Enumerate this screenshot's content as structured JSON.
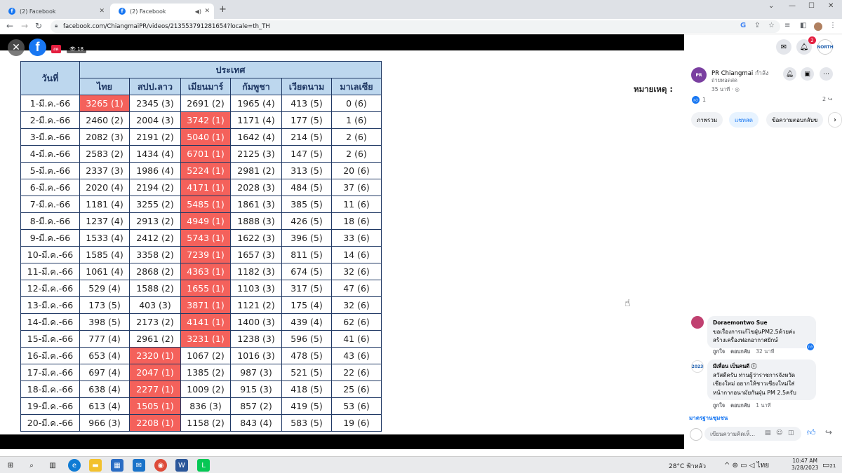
{
  "browser": {
    "tabs": [
      {
        "label": "(2) Facebook",
        "active": false
      },
      {
        "label": "(2) Facebook",
        "active": true
      }
    ],
    "url": "facebook.com/ChiangmaiPR/videos/213553791281654?locale=th_TH"
  },
  "viewer": {
    "live_badge": "สด",
    "views": "18",
    "note_label": "หมายเหตุ :",
    "table": {
      "header_date": "วันที่",
      "header_group": "ประเทศ",
      "countries": [
        "ไทย",
        "สปป.ลาว",
        "เมียนมาร์",
        "กัมพูชา",
        "เวียดนาม",
        "มาเลเซีย"
      ],
      "rows": [
        {
          "date": "1-มี.ค.-66",
          "cells": [
            "3265 (1)",
            "2345 (3)",
            "2691 (2)",
            "1965 (4)",
            "413 (5)",
            "0 (6)"
          ],
          "highlight": 0
        },
        {
          "date": "2-มี.ค.-66",
          "cells": [
            "2460 (2)",
            "2004 (3)",
            "3742 (1)",
            "1171 (4)",
            "177 (5)",
            "1 (6)"
          ],
          "highlight": 2
        },
        {
          "date": "3-มี.ค.-66",
          "cells": [
            "2082 (3)",
            "2191 (2)",
            "5040 (1)",
            "1642 (4)",
            "214 (5)",
            "2 (6)"
          ],
          "highlight": 2
        },
        {
          "date": "4-มี.ค.-66",
          "cells": [
            "2583 (2)",
            "1434 (4)",
            "6701 (1)",
            "2125 (3)",
            "147 (5)",
            "2 (6)"
          ],
          "highlight": 2
        },
        {
          "date": "5-มี.ค.-66",
          "cells": [
            "2337 (3)",
            "1986 (4)",
            "5224 (1)",
            "2981 (2)",
            "313 (5)",
            "20 (6)"
          ],
          "highlight": 2
        },
        {
          "date": "6-มี.ค.-66",
          "cells": [
            "2020 (4)",
            "2194 (2)",
            "4171 (1)",
            "2028 (3)",
            "484 (5)",
            "37 (6)"
          ],
          "highlight": 2
        },
        {
          "date": "7-มี.ค.-66",
          "cells": [
            "1181 (4)",
            "3255 (2)",
            "5485 (1)",
            "1861 (3)",
            "385 (5)",
            "11 (6)"
          ],
          "highlight": 2
        },
        {
          "date": "8-มี.ค.-66",
          "cells": [
            "1237 (4)",
            "2913 (2)",
            "4949 (1)",
            "1888 (3)",
            "426 (5)",
            "18 (6)"
          ],
          "highlight": 2
        },
        {
          "date": "9-มี.ค.-66",
          "cells": [
            "1533 (4)",
            "2412 (2)",
            "5743 (1)",
            "1622 (3)",
            "396 (5)",
            "33 (6)"
          ],
          "highlight": 2
        },
        {
          "date": "10-มี.ค.-66",
          "cells": [
            "1585 (4)",
            "3358 (2)",
            "7239 (1)",
            "1657 (3)",
            "811 (5)",
            "14 (6)"
          ],
          "highlight": 2
        },
        {
          "date": "11-มี.ค.-66",
          "cells": [
            "1061 (4)",
            "2868 (2)",
            "4363 (1)",
            "1182 (3)",
            "674 (5)",
            "32 (6)"
          ],
          "highlight": 2
        },
        {
          "date": "12-มี.ค.-66",
          "cells": [
            "529 (4)",
            "1588 (2)",
            "1655 (1)",
            "1103 (3)",
            "317 (5)",
            "47 (6)"
          ],
          "highlight": 2
        },
        {
          "date": "13-มี.ค.-66",
          "cells": [
            "173 (5)",
            "403 (3)",
            "3871 (1)",
            "1121 (2)",
            "175 (4)",
            "32 (6)"
          ],
          "highlight": 2
        },
        {
          "date": "14-มี.ค.-66",
          "cells": [
            "398 (5)",
            "2173 (2)",
            "4141 (1)",
            "1400 (3)",
            "439 (4)",
            "62 (6)"
          ],
          "highlight": 2
        },
        {
          "date": "15-มี.ค.-66",
          "cells": [
            "777 (4)",
            "2961 (2)",
            "3231 (1)",
            "1238 (3)",
            "596 (5)",
            "41 (6)"
          ],
          "highlight": 2
        },
        {
          "date": "16-มี.ค.-66",
          "cells": [
            "653 (4)",
            "2320 (1)",
            "1067 (2)",
            "1016 (3)",
            "478 (5)",
            "43 (6)"
          ],
          "highlight": 1
        },
        {
          "date": "17-มี.ค.-66",
          "cells": [
            "697 (4)",
            "2047 (1)",
            "1385 (2)",
            "987 (3)",
            "521 (5)",
            "22 (6)"
          ],
          "highlight": 1
        },
        {
          "date": "18-มี.ค.-66",
          "cells": [
            "638 (4)",
            "2277 (1)",
            "1009 (2)",
            "915 (3)",
            "418 (5)",
            "25 (6)"
          ],
          "highlight": 1
        },
        {
          "date": "19-มี.ค.-66",
          "cells": [
            "613 (4)",
            "1505 (1)",
            "836 (3)",
            "857 (2)",
            "419 (5)",
            "53 (6)"
          ],
          "highlight": 1
        },
        {
          "date": "20-มี.ค.-66",
          "cells": [
            "966 (3)",
            "2208 (1)",
            "1158 (2)",
            "843 (4)",
            "583 (5)",
            "19 (6)"
          ],
          "highlight": 1
        }
      ]
    }
  },
  "sidepanel": {
    "notif_count": "2",
    "page_avatar_text": "NORTH",
    "page_name": "PR Chiangmai",
    "page_status": "กำลัง",
    "page_status2": "ถ่ายทอดสด",
    "post_time": "35 นาที · ◎",
    "likes": "1",
    "shares": "2",
    "chips": [
      "ภาพรวม",
      "แชทสด",
      "ข้อความตอบกลับข"
    ],
    "comments": [
      {
        "name": "Doraemontwo Sue",
        "text1": "ขอเรื่องการแก้ไขฝุ่นPM2.5ด้วยค่ะ",
        "text2": "สร้างเครื่องฟอกอากาศยักษ์",
        "like": "ถูกใจ",
        "reply": "ตอบกลับ",
        "time": "32 นาที"
      },
      {
        "name": "มีเพื่อน เป็นคนดี",
        "text1": "สวัสดีครับ ท่านผู้ว่าราชการจังหวัด",
        "text2": "เชียงใหม่ อยากให้ชาวเชียงใหม่ใส่",
        "text3": "หน้ากากอนามัยกันฝุ่น PM 2.5ครับ",
        "like": "ถูกใจ",
        "reply": "ตอบกลับ",
        "time": "1 นาที",
        "avatar_text": "2023"
      }
    ],
    "community_link": "มาตรฐานชุมชน",
    "comment_placeholder": "เขียนความคิดเห็..."
  },
  "taskbar": {
    "weather": "28°C  ฟ้าหลัว",
    "lang": "ไทย",
    "time": "10:47 AM",
    "date": "3/28/2023",
    "notif": "21"
  }
}
